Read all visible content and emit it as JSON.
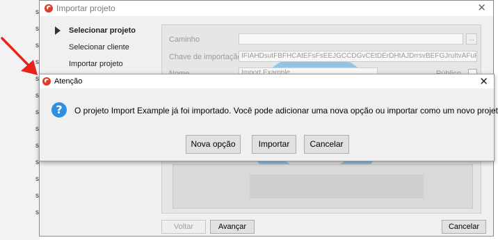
{
  "wizard": {
    "title": "Importar projeto",
    "steps": [
      "Selecionar projeto",
      "Selecionar cliente",
      "Importar projeto"
    ],
    "fields": {
      "caminho_label": "Caminho",
      "caminho_value": "",
      "browse_label": "...",
      "chave_label": "Chave de importação",
      "chave_value": "IFIAHDsutFBFHCAtEFsFsEEJGCCDGvCEtDErDHtAJDrrsvBEFGJruItvAFuHsBDwrBG",
      "nome_label": "Nome",
      "nome_value": "Import Example",
      "publico_label": "Público"
    },
    "buttons": {
      "voltar": "Voltar",
      "avancar": "Avançar",
      "cancelar": "Cancelar"
    },
    "side_letters": [
      "s",
      "s",
      "s",
      "s",
      "s",
      "s",
      "s",
      "s",
      "s",
      "s",
      "s",
      "s",
      "s"
    ]
  },
  "dialog": {
    "title": "Atenção",
    "message": "O projeto Import Example já foi importado. Você pode adicionar uma nova opção ou importar como um novo projeto.",
    "buttons": {
      "nova_opcao": "Nova opção",
      "importar": "Importar",
      "cancelar": "Cancelar"
    },
    "icon": "question-icon"
  },
  "colors": {
    "annotation_arrow": "#e8221b",
    "question_icon": "#2f8fe0",
    "app_icon": "#e23b2a"
  }
}
